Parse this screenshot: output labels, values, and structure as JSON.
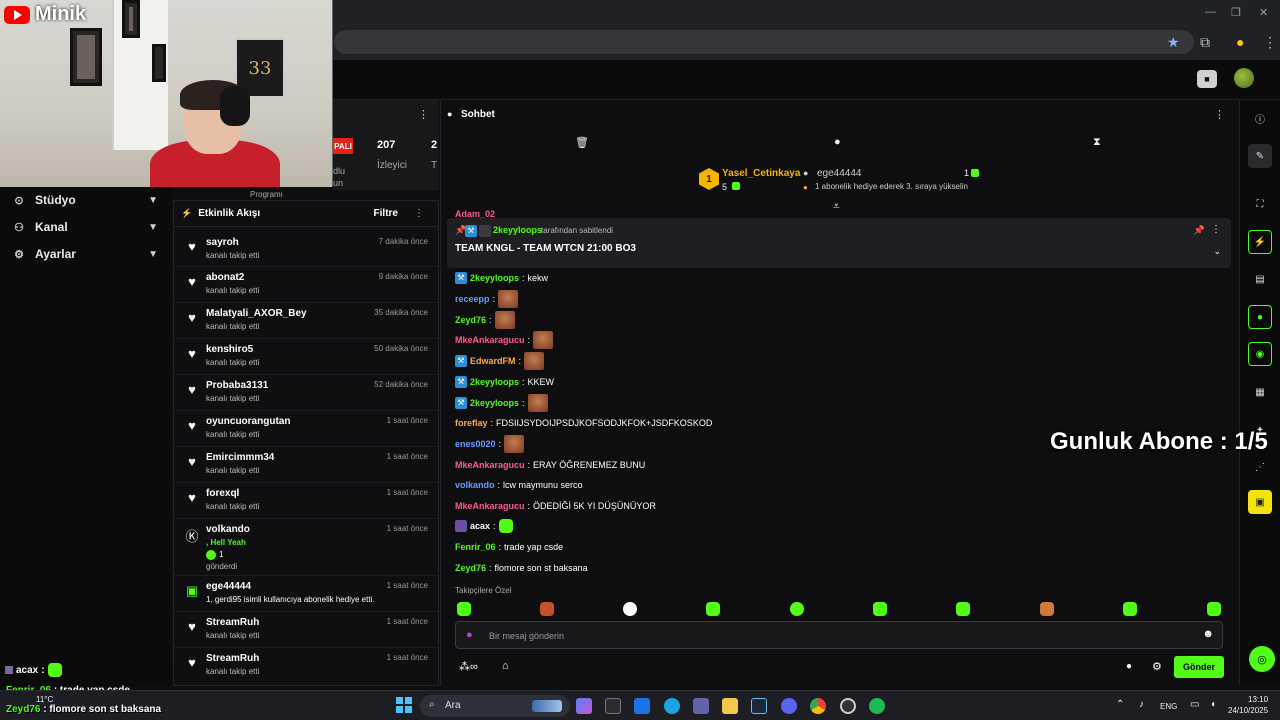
{
  "webcam": {
    "brand": "Minik",
    "jersey_number": "33"
  },
  "leftnav": {
    "items": [
      {
        "label": "Stüdyo",
        "icon": "studio-icon"
      },
      {
        "label": "Kanal",
        "icon": "channel-icon"
      },
      {
        "label": "Ayarlar",
        "icon": "settings-icon"
      }
    ]
  },
  "stats": {
    "live": "PALI",
    "viewers_count": "207",
    "viewers_label": "İzleyici",
    "second_count": "2",
    "second_label": "T",
    "cut_text_1": "dlu",
    "cut_text_2": "un",
    "cut_text_3": "Programı"
  },
  "feed": {
    "title": "Etkinlik Akışı",
    "filter": "Filtre",
    "rows": [
      {
        "name": "sayroh",
        "sub": "kanalı takip etti",
        "time": "7 dakika önce"
      },
      {
        "name": "abonat2",
        "sub": "kanalı takip etti",
        "time": "9 dakika önce"
      },
      {
        "name": "Malatyali_AXOR_Bey",
        "sub": "kanalı takip etti",
        "time": "35 dakika önce"
      },
      {
        "name": "kenshiro5",
        "sub": "kanalı takip etti",
        "time": "50 dakika önce"
      },
      {
        "name": "Probaba3131",
        "sub": "kanalı takip etti",
        "time": "52 dakika önce"
      },
      {
        "name": "oyuncuorangutan",
        "sub": "kanalı takip etti",
        "time": "1 saat önce"
      },
      {
        "name": "Emircimmm34",
        "sub": "kanalı takip etti",
        "time": "1 saat önce"
      },
      {
        "name": "forexql",
        "sub": "kanalı takip etti",
        "time": "1 saat önce"
      },
      {
        "name": "volkando",
        "sub": ", Hell Yeah",
        "extra_count": "1",
        "extra_sub": "gönderdi",
        "time": "1 saat önce"
      },
      {
        "name": "ege44444",
        "sub": "1, gerdi95 isimli kullanıcıya abonelik hediye etti.",
        "time": "1 saat önce"
      },
      {
        "name": "StreamRuh",
        "sub": "kanalı takip etti",
        "time": "1 saat önce"
      },
      {
        "name": "StreamRuh",
        "sub": "kanalı takip etti",
        "time": "1 saat önce"
      }
    ]
  },
  "chat": {
    "title": "Sohbet",
    "leader_1_name": "Yasel_Cetinkaya",
    "leader_1_count": "5",
    "leader_2_name": "ege44444",
    "leader_2_count": "1",
    "leader_2_note": "1 abonelik hediye ederek 3. sıraya yükselin",
    "rank": "1",
    "partial_name": "Adam_02",
    "pinned_by_user": "2keyyloops",
    "pinned_by_suffix": "tarafından sabitlendi",
    "pinned_text": "TEAM KNGL - TEAM WTCN 21:00 BO3",
    "messages": [
      {
        "user": "2keyyloops",
        "text": "kekw"
      },
      {
        "user": "receepp",
        "text": ""
      },
      {
        "user": "Zeyd76",
        "text": ""
      },
      {
        "user": "MkeAnkaragucu",
        "text": ""
      },
      {
        "user": "EdwardFM",
        "text": ""
      },
      {
        "user": "2keyyloops",
        "text": "KKEW"
      },
      {
        "user": "2keyyloops",
        "text": ""
      },
      {
        "user": "foreflay",
        "text": "FDSIIJSYDOIJPSDJKOFSODJKFOK+JSDFKOSKOD"
      },
      {
        "user": "enes0020",
        "text": ""
      },
      {
        "user": "MkeAnkaragucu",
        "text": "ERAY ÖĞRENEMEZ BUNU"
      },
      {
        "user": "volkando",
        "text": "lcw maymunu serco"
      },
      {
        "user": "MkeAnkaragucu",
        "text": "ÖDEDİĞİ 5K YI DÜŞÜNÜYOR"
      },
      {
        "user": "acax",
        "text": ""
      },
      {
        "user": "Fenrir_06",
        "text": "trade yap csde"
      },
      {
        "user": "Zeyd76",
        "text": "flomore son st baksana"
      }
    ],
    "follower_only": "Takipçilere Özel",
    "input_placeholder": "Bir mesaj gönderin",
    "send_label": "Gönder"
  },
  "overlay": {
    "goal": "Gunluk Abone : 1/5",
    "chat_1_user": "acax",
    "chat_2_user": "Fenrir_06",
    "chat_2_text": "trade yap csde",
    "chat_3_user": "Zeyd76",
    "chat_3_text": "flomore son st baksana"
  },
  "taskbar": {
    "search": "Ara",
    "weather": "11°C",
    "lang": "ENG",
    "time": "13:10",
    "date": "24/10/2025"
  },
  "colors": {
    "kick_green": "#53fc18",
    "badge_blue": "#2a8fd6",
    "name_pink": "#ff5c8a",
    "name_blue": "#6a9dff",
    "name_green": "#53fc18",
    "name_orange": "#ffa94d"
  }
}
